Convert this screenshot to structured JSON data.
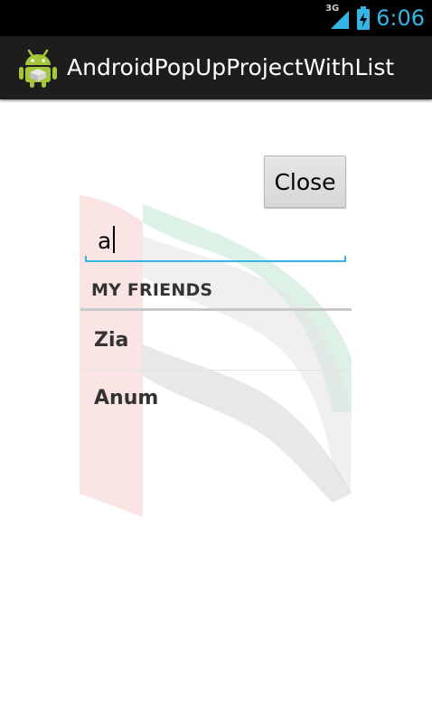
{
  "status_bar": {
    "network": "3G",
    "time": "6:06",
    "accent_color": "#33b5e5"
  },
  "action_bar": {
    "icon": "android-app-icon",
    "title": "AndroidPopUpProjectWithList"
  },
  "popup": {
    "close_label": "Close",
    "search": {
      "value": "a",
      "placeholder": ""
    },
    "section_header": "MY FRIENDS",
    "friends": [
      "Zia",
      "Anum"
    ],
    "background_image": "uae-flag-watermark"
  }
}
